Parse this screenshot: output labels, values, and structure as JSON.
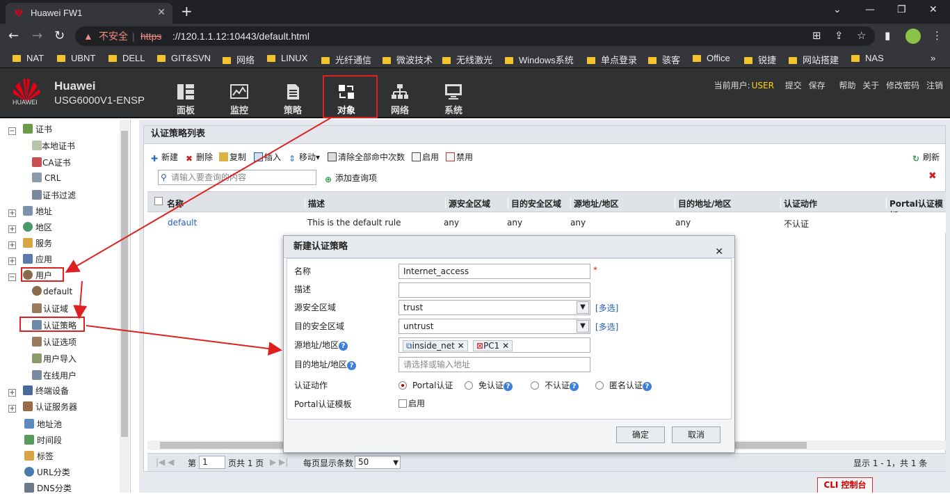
{
  "browser": {
    "tab_title": "Huawei FW1",
    "url_warning": "不安全",
    "url_scheme": "https",
    "url_rest": "://120.1.1.12:10443/default.html",
    "bookmarks": [
      "NAT",
      "UBNT",
      "DELL",
      "GIT&SVN",
      "网络",
      "LINUX",
      "光纤通信",
      "微波技术",
      "无线激光",
      "Windows系统",
      "单点登录",
      "骇客",
      "Office",
      "锐捷",
      "网站搭建",
      "NAS"
    ]
  },
  "header": {
    "logo_text": "HUAWEI",
    "brand_line1": "Huawei",
    "brand_line2": "USG6000V1-ENSP",
    "nav": [
      "面板",
      "监控",
      "策略",
      "对象",
      "网络",
      "系统"
    ],
    "active_nav": "对象",
    "user_label": "当前用户:",
    "user_name": "USER",
    "actions": [
      "提交",
      "保存",
      "帮助",
      "关于",
      "修改密码",
      "注销"
    ]
  },
  "sidebar": {
    "items": [
      {
        "label": "证书",
        "level": 0,
        "expander": "−"
      },
      {
        "label": "本地证书",
        "level": 1
      },
      {
        "label": "CA证书",
        "level": 1
      },
      {
        "label": "CRL",
        "level": 1
      },
      {
        "label": "证书过滤",
        "level": 1
      },
      {
        "label": "地址",
        "level": 0,
        "expander": "+"
      },
      {
        "label": "地区",
        "level": 0,
        "expander": "+"
      },
      {
        "label": "服务",
        "level": 0,
        "expander": "+"
      },
      {
        "label": "应用",
        "level": 0,
        "expander": "+"
      },
      {
        "label": "用户",
        "level": 0,
        "expander": "−"
      },
      {
        "label": "default",
        "level": 1
      },
      {
        "label": "认证域",
        "level": 1
      },
      {
        "label": "认证策略",
        "level": 1,
        "selected": true
      },
      {
        "label": "认证选项",
        "level": 1
      },
      {
        "label": "用户导入",
        "level": 1
      },
      {
        "label": "在线用户",
        "level": 1
      },
      {
        "label": "终端设备",
        "level": 0,
        "expander": "+"
      },
      {
        "label": "认证服务器",
        "level": 0,
        "expander": "+"
      },
      {
        "label": "地址池",
        "level": 0
      },
      {
        "label": "时间段",
        "level": 0
      },
      {
        "label": "标签",
        "level": 0
      },
      {
        "label": "URL分类",
        "level": 0
      },
      {
        "label": "DNS分类",
        "level": 0
      }
    ]
  },
  "main": {
    "panel_title": "认证策略列表",
    "toolbar": [
      "新建",
      "删除",
      "复制",
      "插入",
      "移动",
      "清除全部命中次数",
      "启用",
      "禁用"
    ],
    "refresh": "刷新",
    "search_placeholder": "请输入要查询的内容",
    "add_query": "添加查询项",
    "columns": [
      "名称",
      "描述",
      "源安全区域",
      "目的安全区域",
      "源地址/地区",
      "目的地址/地区",
      "认证动作",
      "Portal认证模板"
    ],
    "rows": [
      {
        "name": "default",
        "desc": "This is the default rule",
        "src_zone": "any",
        "dst_zone": "any",
        "src_addr": "any",
        "dst_addr": "any",
        "action": "不认证"
      }
    ],
    "pager": {
      "page_prefix": "第",
      "page_value": "1",
      "page_suffix": "页共 1 页",
      "per_page_label": "每页显示条数",
      "per_page_value": "50",
      "summary": "显示 1 - 1，共 1 条"
    },
    "cli": "CLI 控制台"
  },
  "dialog": {
    "title": "新建认证策略",
    "fields": {
      "name_label": "名称",
      "name_value": "Internet_access",
      "required_mark": "*",
      "desc_label": "描述",
      "desc_value": "",
      "src_zone_label": "源安全区域",
      "src_zone_value": "trust",
      "dst_zone_label": "目的安全区域",
      "dst_zone_value": "untrust",
      "multi_select": "[多选]",
      "src_addr_label": "源地址/地区",
      "src_addr_chips": [
        "inside_net",
        "PC1"
      ],
      "dst_addr_label": "目的地址/地区",
      "dst_addr_placeholder": "请选择或输入地址",
      "action_label": "认证动作",
      "action_options": [
        "Portal认证",
        "免认证",
        "不认证",
        "匿名认证"
      ],
      "action_selected": "Portal认证",
      "portal_label": "Portal认证模板",
      "portal_enable": "启用"
    },
    "ok": "确定",
    "cancel": "取消"
  },
  "colors": {
    "annotation": "#e02020",
    "link": "#1f5fbf",
    "header_bg": "#2f3133",
    "user_name": "#ffd800"
  }
}
